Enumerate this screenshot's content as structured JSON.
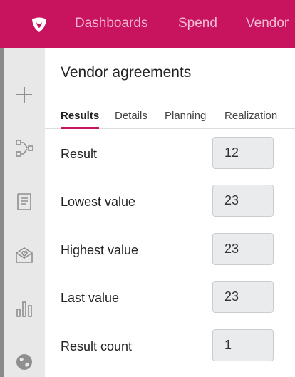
{
  "topbar": {
    "brand_color": "#c8145f",
    "logo_icon": "heart-shield-logo-icon",
    "nav": [
      "Dashboards",
      "Spend",
      "Vendor"
    ]
  },
  "sidebar": {
    "icons": [
      "plus-icon",
      "flow-diagram-icon",
      "document-icon",
      "mail-heart-icon",
      "bar-chart-icon",
      "globe-icon"
    ]
  },
  "page": {
    "title": "Vendor agreements"
  },
  "tabs": {
    "items": [
      "Results",
      "Details",
      "Planning",
      "Realization"
    ],
    "active": "Results"
  },
  "fields": [
    {
      "label": "Result",
      "value": "12"
    },
    {
      "label": "Lowest value",
      "value": "23"
    },
    {
      "label": "Highest value",
      "value": "23"
    },
    {
      "label": "Last value",
      "value": "23"
    },
    {
      "label": "Result count",
      "value": "1"
    }
  ]
}
